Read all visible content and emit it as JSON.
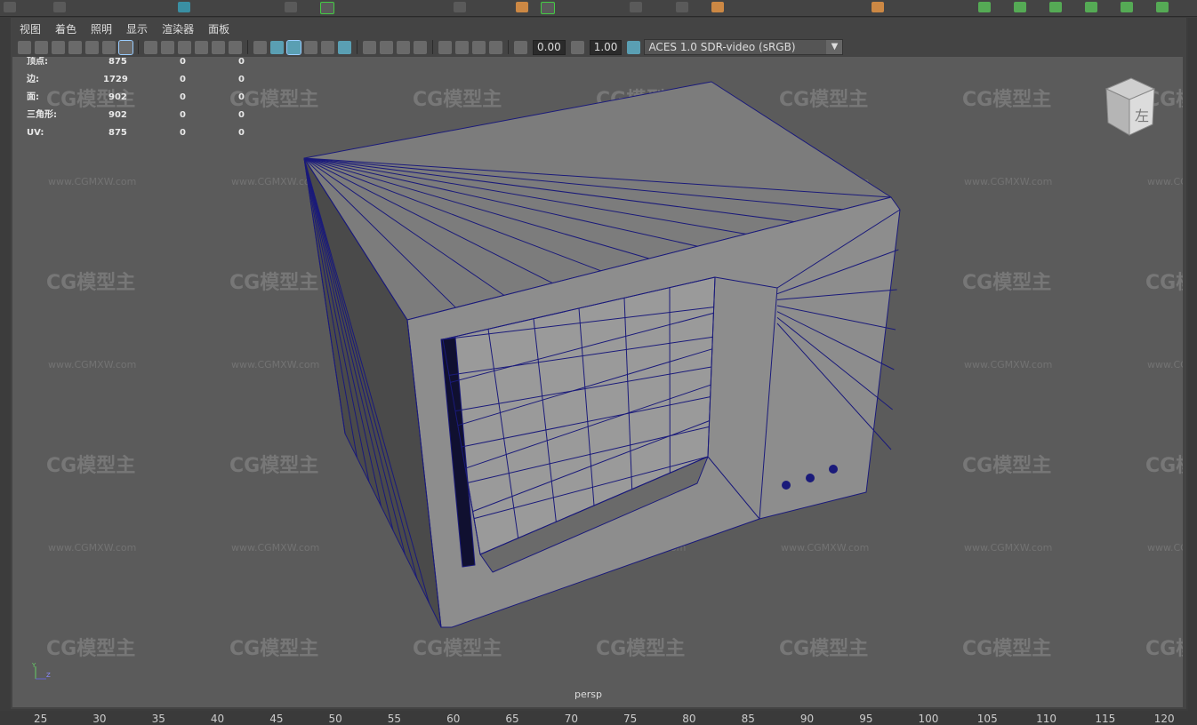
{
  "menu": [
    "视图",
    "着色",
    "照明",
    "显示",
    "渲染器",
    "面板"
  ],
  "toolbar": {
    "value_a": "0.00",
    "value_b": "1.00",
    "colorspace": "ACES 1.0 SDR-video (sRGB)",
    "icons": [
      "camera-icon",
      "film-gate-icon",
      "lock-camera-icon",
      "bookmark-icon",
      "tumble-icon",
      "pan-icon",
      "pencil-icon",
      "grid-icon",
      "resolution-gate-icon",
      "field-chart-icon",
      "safe-action-icon",
      "safe-title-icon",
      "wireframe-icon",
      "smooth-shade-icon",
      "wire-on-shaded-icon",
      "textured-icon",
      "use-lights-icon",
      "shadows-icon",
      "ambient-occlusion-icon",
      "motion-blur-icon",
      "anti-alias-icon",
      "depth-of-field-icon",
      "isolate-select-icon",
      "xray-icon",
      "xray-joints-icon",
      "backface-icon",
      "exposure-icon",
      "gamma-icon",
      "color-management-icon"
    ]
  },
  "stats": [
    {
      "label": "顶点:",
      "a": "875",
      "b": "0",
      "c": "0"
    },
    {
      "label": "边:",
      "a": "1729",
      "b": "0",
      "c": "0"
    },
    {
      "label": "面:",
      "a": "902",
      "b": "0",
      "c": "0"
    },
    {
      "label": "三角形:",
      "a": "902",
      "b": "0",
      "c": "0"
    },
    {
      "label": "UV:",
      "a": "875",
      "b": "0",
      "c": "0"
    }
  ],
  "viewcube_label": "左",
  "camera_name": "persp",
  "watermark": {
    "logo": "CG模型主",
    "url": "www.CGMXW.com"
  },
  "axis": {
    "y": "Y",
    "z": "Z"
  },
  "ruler": [
    "25",
    "30",
    "35",
    "40",
    "45",
    "50",
    "55",
    "60",
    "65",
    "70",
    "75",
    "80",
    "85",
    "90",
    "95",
    "100",
    "105",
    "110",
    "115",
    "120"
  ],
  "colors": {
    "viewport": "#5b5b5b",
    "wire": "#1a1a7a",
    "face": "#8a8a8a"
  }
}
